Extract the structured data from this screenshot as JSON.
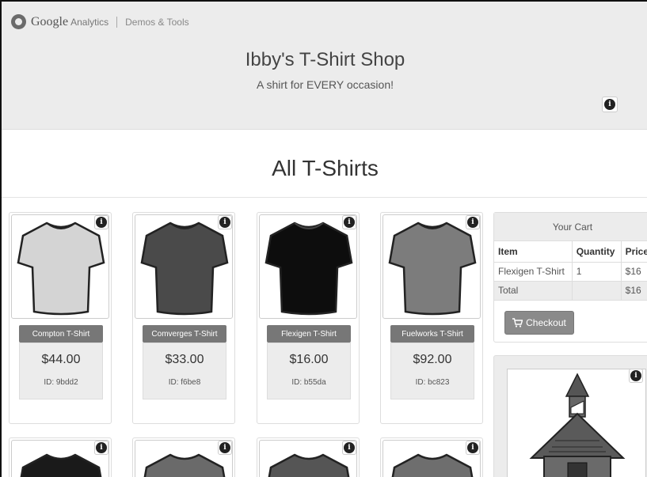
{
  "header": {
    "brand_google": "Google",
    "brand_analytics": "Analytics",
    "brand_demos": "Demos & Tools",
    "shop_title": "Ibby's T-Shirt Shop",
    "tagline": "A shirt for EVERY occasion!"
  },
  "section": {
    "title": "All T-Shirts"
  },
  "products": [
    {
      "name": "Compton T-Shirt",
      "price": "$44.00",
      "id": "ID: 9bdd2",
      "color": "#d4d4d4"
    },
    {
      "name": "Comverges T-Shirt",
      "price": "$33.00",
      "id": "ID: f6be8",
      "color": "#4a4a4a"
    },
    {
      "name": "Flexigen T-Shirt",
      "price": "$16.00",
      "id": "ID: b55da",
      "color": "#0d0d0d"
    },
    {
      "name": "Fuelworks T-Shirt",
      "price": "$92.00",
      "id": "ID: bc823",
      "color": "#7c7c7c"
    }
  ],
  "products_row2_colors": [
    "#1a1a1a",
    "#6a6a6a",
    "#555555",
    "#6e6e6e"
  ],
  "cart": {
    "title": "Your Cart",
    "col_item": "Item",
    "col_qty": "Quantity",
    "col_price": "Price",
    "rows": [
      {
        "item": "Flexigen T-Shirt",
        "qty": "1",
        "price": "$16"
      }
    ],
    "total_label": "Total",
    "total_value": "$16",
    "checkout_label": "Checkout"
  },
  "icons": {
    "info": "info-icon",
    "cart": "cart-icon",
    "logo": "google-analytics-logo-icon"
  }
}
